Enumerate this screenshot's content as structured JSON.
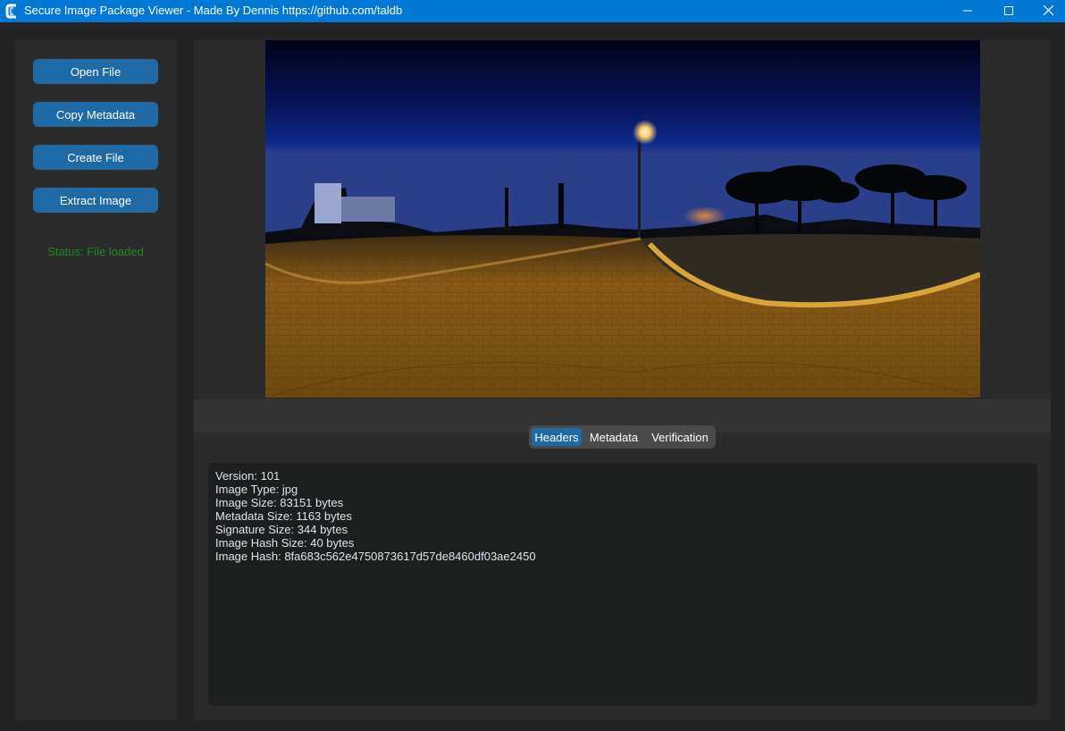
{
  "window": {
    "title": "Secure Image Package Viewer - Made By Dennis https://github.com/taldb",
    "accent_color": "#0078d4",
    "icons": [
      "app-icon",
      "minimize-icon",
      "maximize-icon",
      "close-icon"
    ]
  },
  "sidebar": {
    "buttons": {
      "open_file": "Open File",
      "copy_metadata": "Copy Metadata",
      "create_file": "Create File",
      "extract_image": "Extract Image"
    },
    "button_color": "#1f6aa5",
    "status": {
      "text": "Status: File loaded",
      "color": "#1f8a1f"
    }
  },
  "preview": {
    "image": "equirectangular night street panorama with street lamp, trees and brick pavement"
  },
  "tabs": {
    "items": [
      "Headers",
      "Metadata",
      "Verification"
    ],
    "selected": "Headers"
  },
  "headers": {
    "lines": [
      "Version: 101",
      "Image Type: jpg",
      "Image Size: 83151 bytes",
      "Metadata Size: 1163 bytes",
      "Signature Size: 344 bytes",
      "Image Hash Size: 40 bytes",
      "Image Hash: 8fa683c562e4750873617d57de8460df03ae2450"
    ]
  }
}
